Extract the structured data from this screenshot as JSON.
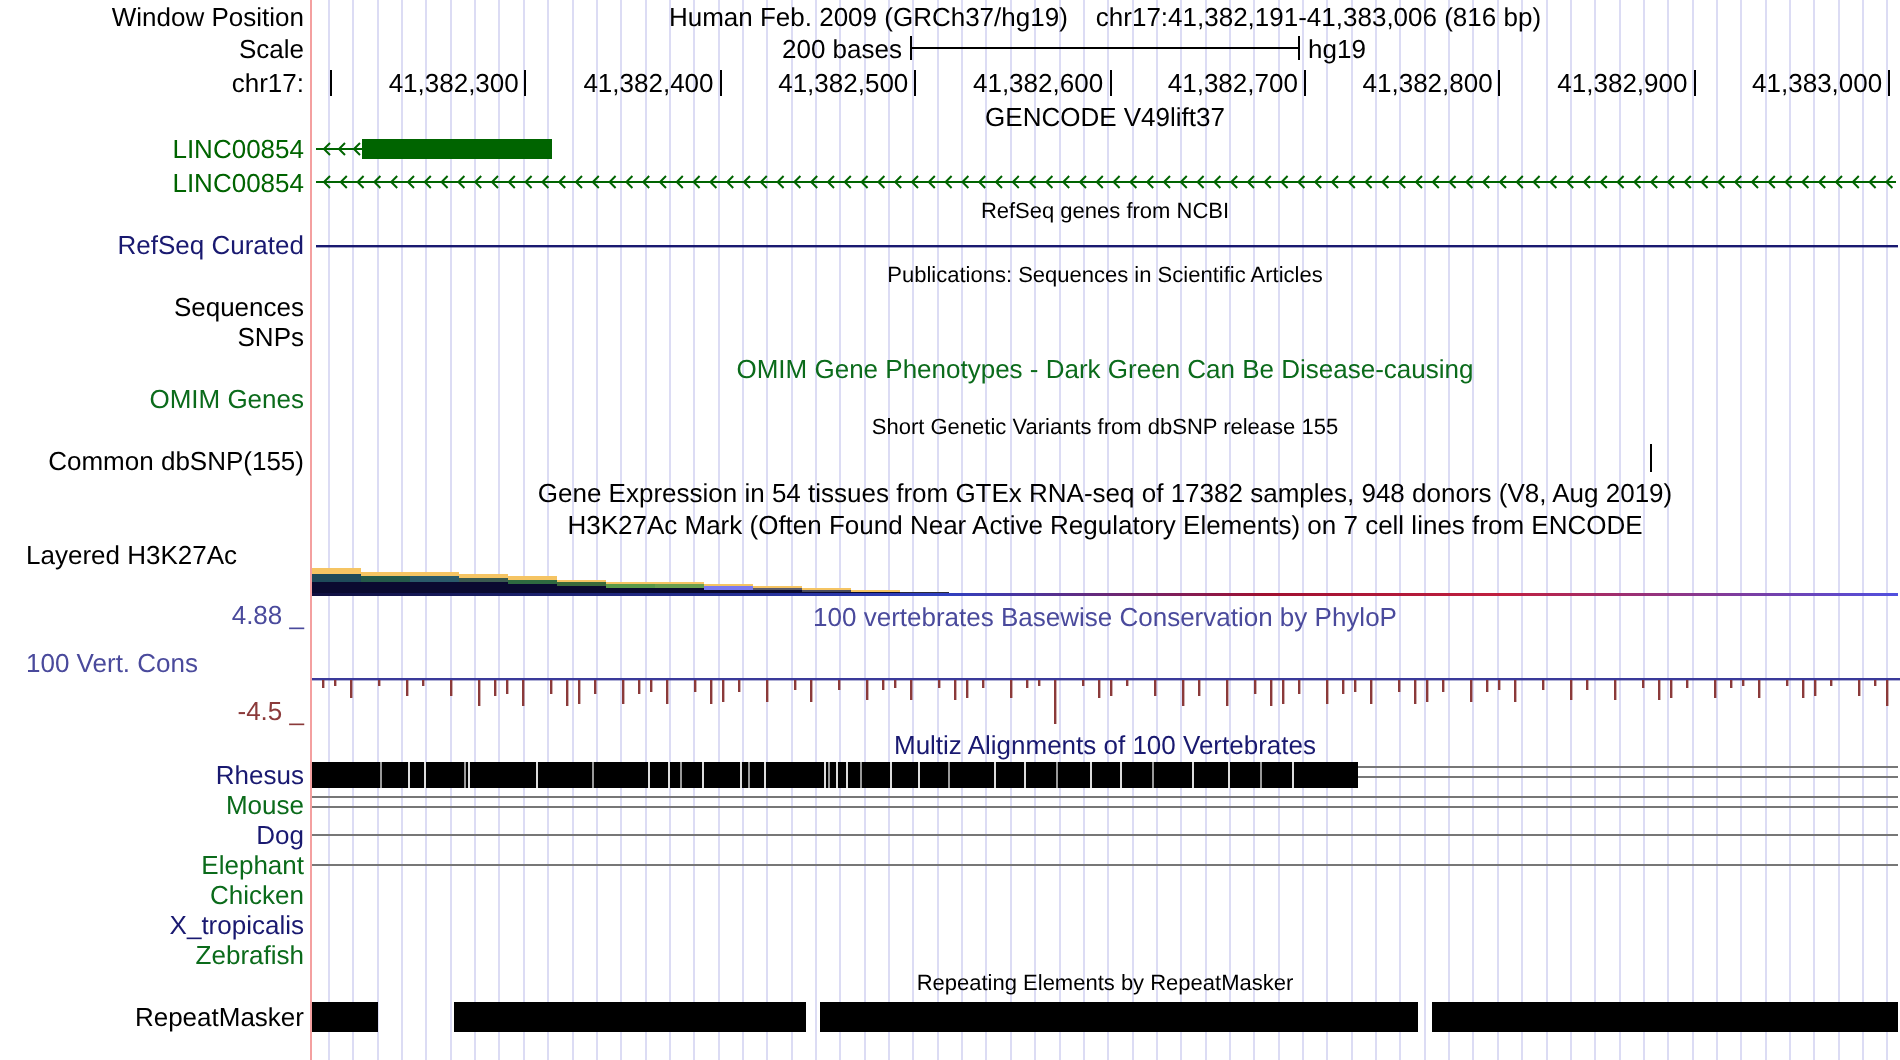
{
  "header": {
    "label": "Window Position",
    "title": "Human Feb. 2009 (GRCh37/hg19)",
    "position": "chr17:41,382,191-41,383,006 (816 bp)"
  },
  "scale": {
    "label": "Scale",
    "bases": "200 bases",
    "assembly": "hg19"
  },
  "ruler": {
    "label": "chr17:",
    "ticks": [
      "41,382,300",
      "41,382,400",
      "41,382,500",
      "41,382,600",
      "41,382,700",
      "41,382,800",
      "41,382,900",
      "41,383,000"
    ]
  },
  "tracks": [
    {
      "kind": "title",
      "text": "GENCODE V49lift37",
      "color": "#000000"
    },
    {
      "kind": "gene-block",
      "label": "LINC00854",
      "color": "#006400"
    },
    {
      "kind": "gene",
      "label": "LINC00854",
      "color": "#006400"
    },
    {
      "kind": "subtitle",
      "text": "RefSeq genes from NCBI"
    },
    {
      "kind": "line",
      "label": "RefSeq Curated",
      "color": "#191970"
    },
    {
      "kind": "subtitle",
      "text": "Publications: Sequences in Scientific Articles"
    },
    {
      "kind": "label",
      "label": "Sequences",
      "color": "#000000"
    },
    {
      "kind": "label",
      "label": "SNPs",
      "color": "#000000"
    },
    {
      "kind": "title",
      "text": "OMIM Gene Phenotypes - Dark Green Can Be Disease-causing",
      "color": "#0b6b1b"
    },
    {
      "kind": "label",
      "label": "OMIM Genes",
      "color": "#0b6b1b"
    },
    {
      "kind": "subtitle",
      "text": "Short Genetic Variants from dbSNP release 155"
    },
    {
      "kind": "snp",
      "label": "Common dbSNP(155)",
      "color": "#000000"
    },
    {
      "kind": "title",
      "text": "Gene Expression in 54 tissues from GTEx RNA-seq of 17382 samples, 948 donors (V8, Aug 2019)",
      "color": "#000000"
    },
    {
      "kind": "title",
      "text": "H3K27Ac Mark (Often Found Near Active Regulatory Elements) on 7 cell lines from ENCODE",
      "color": "#000000"
    },
    {
      "kind": "group-label",
      "label": "Layered H3K27Ac",
      "color": "#000000"
    },
    {
      "kind": "layered"
    },
    {
      "kind": "phylop",
      "max": {
        "text": "4.88 _",
        "color": "#4a4a9c"
      },
      "name": {
        "text": "100 Vert. Cons",
        "color": "#4a4a9c"
      },
      "min": {
        "text": "-4.5 _",
        "color": "#8b3a3a"
      },
      "title": "100 vertebrates Basewise Conservation by PhyloP",
      "color": "#4a4a9c"
    },
    {
      "kind": "title",
      "text": "Multiz Alignments of 100 Vertebrates",
      "color": "#191970"
    },
    {
      "kind": "species-blocks",
      "label": "Rhesus",
      "color": "#191970"
    },
    {
      "kind": "species-double",
      "label": "Mouse",
      "color": "#0b6b1b"
    },
    {
      "kind": "species-single",
      "label": "Dog",
      "color": "#191970"
    },
    {
      "kind": "species-single",
      "label": "Elephant",
      "color": "#0b6b1b"
    },
    {
      "kind": "species",
      "label": "Chicken",
      "color": "#0b6b1b"
    },
    {
      "kind": "species",
      "label": "X_tropicalis",
      "color": "#191970"
    },
    {
      "kind": "species",
      "label": "Zebrafish",
      "color": "#0b6b1b"
    },
    {
      "kind": "subtitle",
      "text": "Repeating Elements by RepeatMasker"
    },
    {
      "kind": "repeat",
      "label": "RepeatMasker",
      "color": "#000000"
    }
  ]
}
